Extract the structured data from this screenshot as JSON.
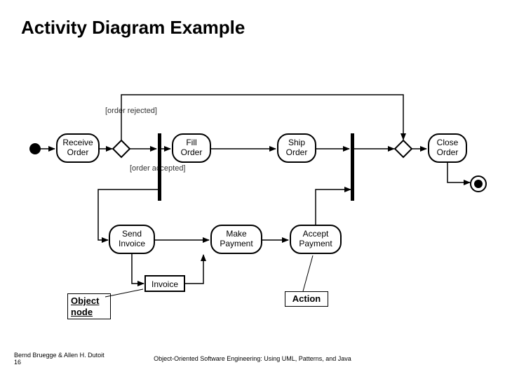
{
  "title": "Activity Diagram Example",
  "guards": {
    "rejected": "[order rejected]",
    "accepted": "[order accepted]"
  },
  "activities": {
    "receive": "Receive\nOrder",
    "fill": "Fill\nOrder",
    "ship": "Ship\nOrder",
    "close": "Close\nOrder",
    "sendInvoice": "Send\nInvoice",
    "makePayment": "Make\nPayment",
    "acceptPayment": "Accept\nPayment"
  },
  "object": "Invoice",
  "callouts": {
    "objectNode": "Object node",
    "action": "Action"
  },
  "footer": {
    "left": "Bernd Bruegge & Allen H. Dutoit",
    "page": "16",
    "center": "Object-Oriented Software Engineering: Using UML, Patterns, and Java"
  }
}
